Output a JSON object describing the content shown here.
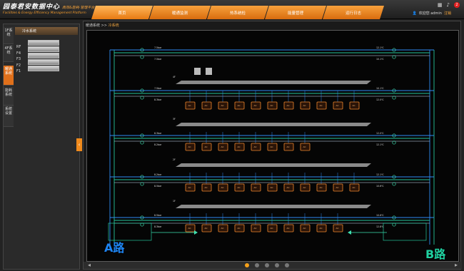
{
  "header": {
    "title": "园泰君安数据中心",
    "subtitle": "高效&能耗·管理平台",
    "title_en": "Facilities & Energy Efficiency Management Platform",
    "tabs": [
      "首页",
      "暖通监测",
      "热系统检",
      "能量管理",
      "运行日志"
    ],
    "user_label": "欢迎您 admin",
    "logout": "注销",
    "alert_count": "2"
  },
  "sidebar": {
    "vtabs": [
      "1F系统",
      "4F系统",
      "暖通系统",
      "能耗系统",
      "系统设置"
    ],
    "head": "冷水系统",
    "floors": [
      "RF",
      "F4",
      "F3",
      "F2",
      "F1"
    ]
  },
  "breadcrumb": {
    "root": "暖通系统",
    "sep": ">>",
    "current": "冷系统"
  },
  "diagram": {
    "label_a": "A路",
    "label_b": "B路",
    "floor_tags": [
      "4F",
      "3F",
      "2F",
      "1F"
    ],
    "left_readings": [
      "7.5bar",
      "7.5bar",
      "8.3bar",
      "8.2bar",
      "8.5bar",
      "8.3bar",
      "8.5bar",
      "8.0bar"
    ],
    "right_readings": [
      "12.1℃",
      "10.1℃",
      "12.0℃",
      "12.1℃",
      "10.6℃",
      "12.8℃",
      "10.4℃",
      "12.8℃"
    ],
    "unit_rows": [
      10,
      11,
      8,
      11,
      10
    ]
  },
  "pager": {
    "count": 5,
    "active": 0
  },
  "colors": {
    "accent": "#f08a1c",
    "pipe_blue": "#2e8cf5",
    "pipe_green": "#25c59a",
    "unit_stroke": "#f0872c"
  }
}
